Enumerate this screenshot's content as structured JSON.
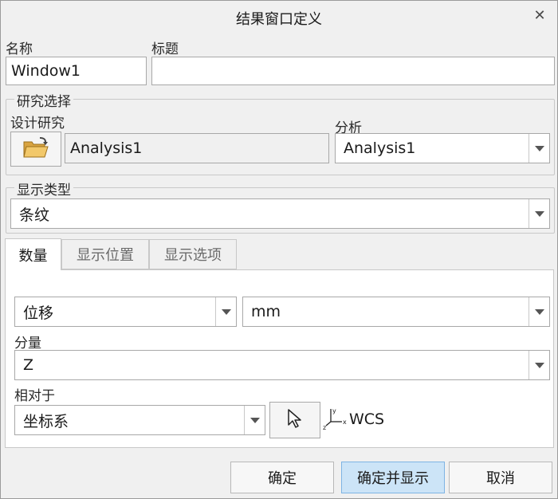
{
  "window": {
    "title": "结果窗口定义",
    "close_glyph": "✕"
  },
  "fields": {
    "name_label": "名称",
    "name_value": "Window1",
    "title_label": "标题",
    "title_value": ""
  },
  "study_selection": {
    "group_title": "研究选择",
    "design_study_label": "设计研究",
    "design_study_value": "Analysis1",
    "analysis_label": "分析",
    "analysis_value": "Analysis1",
    "folder_icon": "open-folder-icon"
  },
  "display_type": {
    "group_title": "显示类型",
    "value": "条纹"
  },
  "tabs": [
    {
      "label": "数量",
      "active": true
    },
    {
      "label": "显示位置",
      "active": false
    },
    {
      "label": "显示选项",
      "active": false
    }
  ],
  "quantity": {
    "quantity_value": "位移",
    "unit_value": "mm",
    "component_label": "分量",
    "component_value": "Z",
    "relative_label": "相对于",
    "relative_value": "坐标系",
    "coord_system_name": "WCS"
  },
  "buttons": {
    "ok": "确定",
    "ok_show": "确定并显示",
    "cancel": "取消"
  },
  "colors": {
    "primary_button_bg": "#cce4f7",
    "dialog_bg": "#f0f0f0"
  }
}
